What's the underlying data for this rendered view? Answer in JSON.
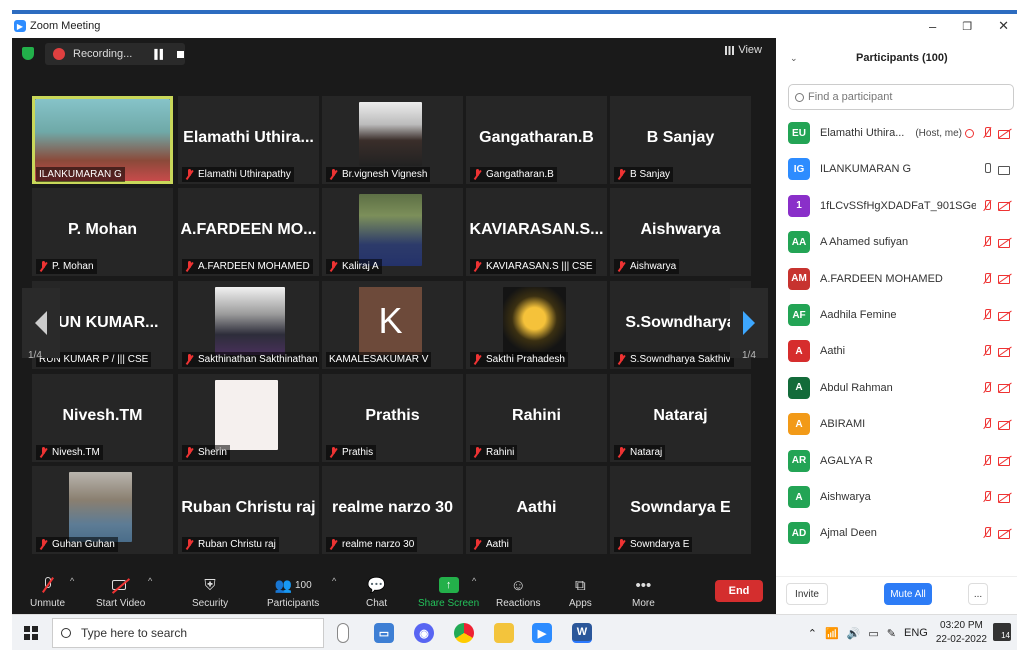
{
  "window": {
    "title": "Zoom Meeting",
    "controls": [
      "–",
      "❐",
      "✕"
    ]
  },
  "recording": {
    "label": "Recording..."
  },
  "view": {
    "label": "View"
  },
  "pager": {
    "left": "1/4",
    "right": "1/4"
  },
  "tiles": [
    {
      "big": "",
      "caption": "ILANKUMARAN G",
      "photo": true,
      "active": true,
      "muted": false
    },
    {
      "big": "Elamathi Uthira...",
      "caption": "Elamathi Uthirapathy",
      "muted": true
    },
    {
      "big": "",
      "caption": "Br.vignesh Vignesh",
      "photo": true,
      "muted": true
    },
    {
      "big": "Gangatharan.B",
      "caption": "Gangatharan.B",
      "muted": true
    },
    {
      "big": "B Sanjay",
      "caption": "B Sanjay",
      "muted": true
    },
    {
      "big": "P. Mohan",
      "caption": "P. Mohan",
      "muted": true
    },
    {
      "big": "A.FARDEEN MO...",
      "caption": "A.FARDEEN MOHAMED",
      "muted": true
    },
    {
      "big": "",
      "caption": "Kaliraj A",
      "photo": true,
      "muted": true
    },
    {
      "big": "KAVIARASAN.S...",
      "caption": "KAVIARASAN.S ||| CSE",
      "muted": true
    },
    {
      "big": "Aishwarya",
      "caption": "Aishwarya",
      "muted": true
    },
    {
      "big": "RUN KUMAR...",
      "caption": "RUN KUMAR P / ||| CSE",
      "muted": false
    },
    {
      "big": "",
      "caption": "Sakthinathan Sakthinathan",
      "photo": true,
      "muted": true
    },
    {
      "big": "",
      "caption": "KAMALESAKUMAR V",
      "letter": "K",
      "muted": false
    },
    {
      "big": "",
      "caption": "Sakthi Prahadesh",
      "photo": true,
      "muted": true
    },
    {
      "big": "S.Sowndharya",
      "caption": "S.Sowndharya Sakthiv",
      "muted": true
    },
    {
      "big": "Nivesh.TM",
      "caption": "Nivesh.TM",
      "muted": true
    },
    {
      "big": "",
      "caption": "Sherin",
      "photo": true,
      "muted": true
    },
    {
      "big": "Prathis",
      "caption": "Prathis",
      "muted": true
    },
    {
      "big": "Rahini",
      "caption": "Rahini",
      "muted": true
    },
    {
      "big": "Nataraj",
      "caption": "Nataraj",
      "muted": true
    },
    {
      "big": "",
      "caption": "Guhan Guhan",
      "photo": true,
      "muted": true
    },
    {
      "big": "Ruban Christu raj",
      "caption": "Ruban Christu raj",
      "muted": true
    },
    {
      "big": "realme narzo 30",
      "caption": "realme narzo 30",
      "muted": true
    },
    {
      "big": "Aathi",
      "caption": "Aathi",
      "muted": true
    },
    {
      "big": "Sowndarya E",
      "caption": "Sowndarya E",
      "muted": true
    }
  ],
  "toolbar": {
    "unmute": "Unmute",
    "start_video": "Start Video",
    "security": "Security",
    "participants": "Participants",
    "participants_count": "100",
    "chat": "Chat",
    "share_screen": "Share Screen",
    "reactions": "Reactions",
    "apps": "Apps",
    "more": "More",
    "end": "End"
  },
  "panel": {
    "title": "Participants (100)",
    "search_placeholder": "Find a participant",
    "participants": [
      {
        "initials": "EU",
        "name": "Elamathi Uthira...",
        "note": "(Host, me)",
        "color": "#23a455",
        "state": "host"
      },
      {
        "initials": "IG",
        "name": "ILANKUMARAN G",
        "color": "#2d8cff",
        "state": "on"
      },
      {
        "initials": "1",
        "name": "1fLCvSSfHgXDADFaT_901SGey...",
        "color": "#8a2fc9",
        "state": "off"
      },
      {
        "initials": "AA",
        "name": "A Ahamed sufiyan",
        "color": "#23a455",
        "state": "off"
      },
      {
        "initials": "AM",
        "name": "A.FARDEEN MOHAMED",
        "color": "#c7332f",
        "state": "off"
      },
      {
        "initials": "AF",
        "name": "Aadhila Femine",
        "color": "#23a455",
        "state": "off"
      },
      {
        "initials": "A",
        "name": "Aathi",
        "color": "#d62d2d",
        "state": "off"
      },
      {
        "initials": "A",
        "name": "Abdul Rahman",
        "color": "#136b3a",
        "state": "off"
      },
      {
        "initials": "A",
        "name": "ABIRAMI",
        "color": "#f29a18",
        "state": "off"
      },
      {
        "initials": "AR",
        "name": "AGALYA R",
        "color": "#23a455",
        "state": "off"
      },
      {
        "initials": "A",
        "name": "Aishwarya",
        "color": "#23a455",
        "state": "off"
      },
      {
        "initials": "AD",
        "name": "Ajmal Deen",
        "color": "#23a455",
        "state": "off"
      }
    ],
    "invite": "Invite",
    "mute_all": "Mute All",
    "more": "..."
  },
  "taskbar": {
    "search_placeholder": "Type here to search",
    "lang": "ENG",
    "time": "03:20 PM",
    "date": "22-02-2022",
    "notifications": "14"
  }
}
